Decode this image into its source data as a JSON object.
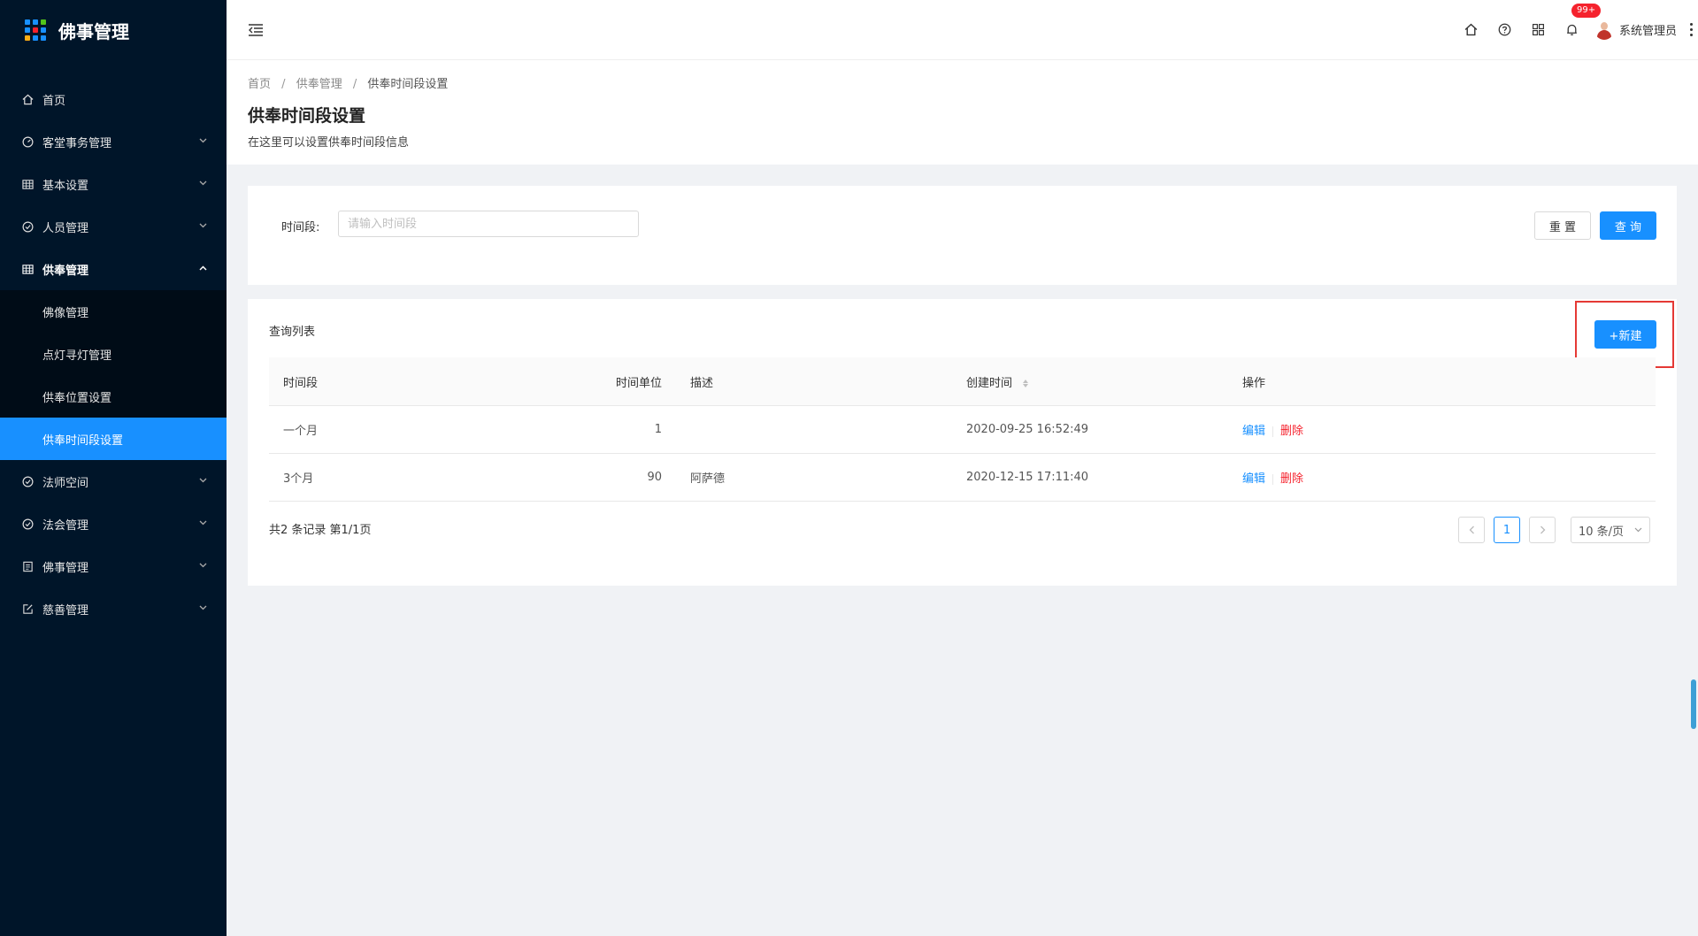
{
  "brand": {
    "title": "佛事管理"
  },
  "sidebar": {
    "items": [
      {
        "label": "首页",
        "icon": "home-icon"
      },
      {
        "label": "客堂事务管理",
        "icon": "dashboard-icon"
      },
      {
        "label": "基本设置",
        "icon": "table-icon"
      },
      {
        "label": "人员管理",
        "icon": "check-circle-icon"
      },
      {
        "label": "供奉管理",
        "icon": "table-icon"
      },
      {
        "label": "法师空间",
        "icon": "check-circle-icon"
      },
      {
        "label": "法会管理",
        "icon": "check-circle-icon"
      },
      {
        "label": "佛事管理",
        "icon": "profile-icon"
      },
      {
        "label": "慈善管理",
        "icon": "form-icon"
      }
    ],
    "submenu": [
      {
        "label": "佛像管理"
      },
      {
        "label": "点灯寻灯管理"
      },
      {
        "label": "供奉位置设置"
      },
      {
        "label": "供奉时间段设置"
      }
    ]
  },
  "header": {
    "notification_badge": "99+",
    "user_name": "系统管理员"
  },
  "breadcrumb": [
    "首页",
    "供奉管理",
    "供奉时间段设置"
  ],
  "page": {
    "title": "供奉时间段设置",
    "description": "在这里可以设置供奉时间段信息"
  },
  "search": {
    "label": "时间段:",
    "placeholder": "请输入时间段",
    "value": "",
    "reset_label": "重 置",
    "query_label": "查 询"
  },
  "list": {
    "title": "查询列表",
    "new_label": "+新建",
    "columns": [
      "时间段",
      "时间单位",
      "描述",
      "创建时间",
      "操作"
    ],
    "rows": [
      {
        "period": "一个月",
        "unit": "1",
        "desc": "",
        "created": "2020-09-25 16:52:49",
        "edit": "编辑",
        "delete": "删除"
      },
      {
        "period": "3个月",
        "unit": "90",
        "desc": "阿萨德",
        "created": "2020-12-15 17:11:40",
        "edit": "编辑",
        "delete": "删除"
      }
    ],
    "total_text": "共2 条记录 第1/1页"
  },
  "pagination": {
    "current_page": "1",
    "page_size": "10 条/页"
  },
  "colors": {
    "sidebar_bg": "#001529",
    "primary": "#1890ff",
    "danger": "#f5222d",
    "highlight_box": "#e53935"
  }
}
